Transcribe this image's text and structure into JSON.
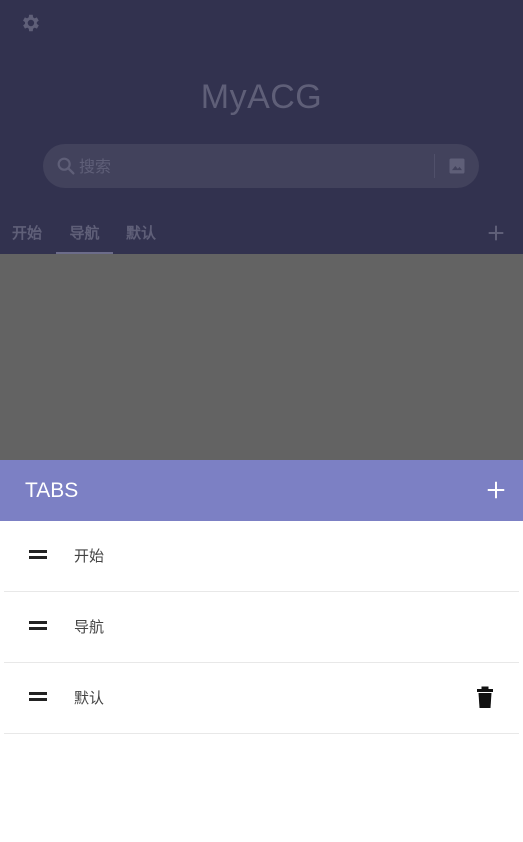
{
  "app": {
    "title": "MyACG"
  },
  "search": {
    "placeholder": "搜索"
  },
  "tabs": [
    {
      "label": "开始"
    },
    {
      "label": "导航",
      "active": true
    },
    {
      "label": "默认"
    }
  ],
  "sheet": {
    "title": "TABS",
    "items": [
      {
        "label": "开始"
      },
      {
        "label": "导航"
      },
      {
        "label": "默认",
        "deletable": true
      }
    ]
  },
  "icons": {
    "settings": "gear-icon",
    "search": "search-icon",
    "image_search": "image-icon",
    "add": "plus-icon",
    "drag": "drag-handle-icon",
    "delete": "trash-icon"
  },
  "colors": {
    "header_dimmed": "#32324f",
    "sheet_header": "#7c80c4",
    "content_dimmed": "#636363"
  }
}
